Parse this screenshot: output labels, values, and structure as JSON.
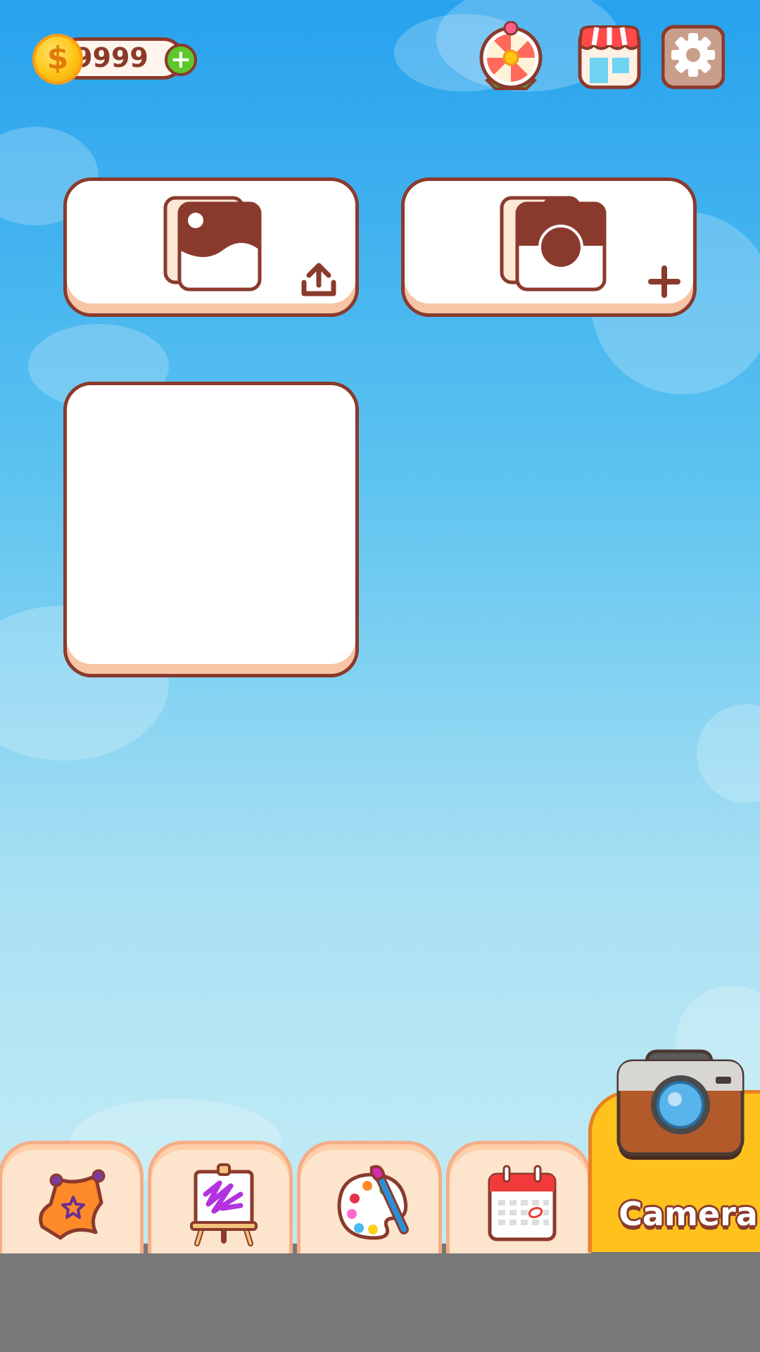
{
  "header": {
    "coin_balance": "9999",
    "coin_symbol": "$",
    "add_coins_symbol": "+",
    "icons": [
      "coin-icon",
      "add-coins-icon",
      "lucky-wheel-icon",
      "shop-icon",
      "settings-icon"
    ]
  },
  "main": {
    "cards": [
      {
        "name": "import-photo-card",
        "icon": "photo-upload-icon"
      },
      {
        "name": "take-photo-card",
        "icon": "camera-add-icon"
      },
      {
        "name": "empty-slot-card",
        "icon": ""
      }
    ]
  },
  "bottom_nav": {
    "tabs": [
      {
        "name": "tab-quests",
        "icon": "scroll-star-icon"
      },
      {
        "name": "tab-drawing",
        "icon": "easel-icon"
      },
      {
        "name": "tab-palette",
        "icon": "paint-palette-icon"
      },
      {
        "name": "tab-calendar",
        "icon": "calendar-icon"
      }
    ],
    "active_tab_label": "Camera",
    "active_tab_icon": "camera-icon"
  },
  "colors": {
    "outline_brown": "#8a3a2c",
    "sky_top": "#27a2ee",
    "sky_bottom": "#c3ecf5",
    "coin_gold": "#ffc414",
    "plus_green": "#5ec72a",
    "camera_tab_yellow": "#ffc21c",
    "tab_peach": "#fde4cc"
  }
}
